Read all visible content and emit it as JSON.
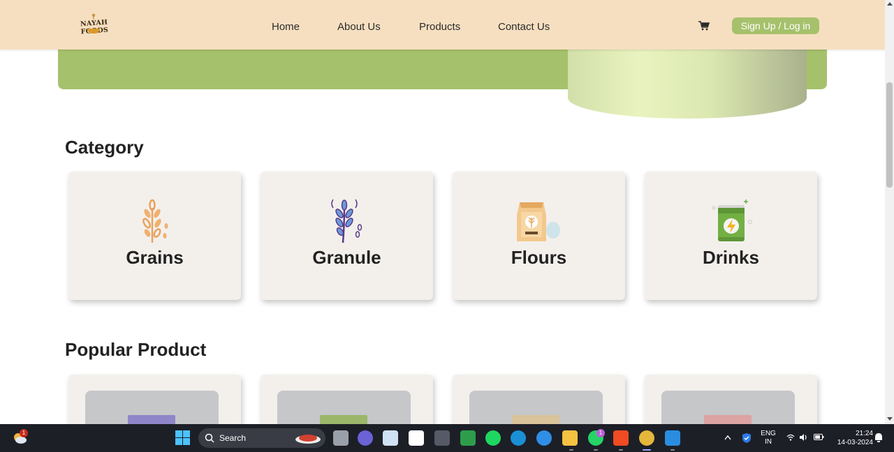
{
  "brand": {
    "name": "NAYAH FOODS"
  },
  "nav": {
    "links": [
      "Home",
      "About Us",
      "Products",
      "Contact Us"
    ],
    "signup_label": "Sign Up / Log in"
  },
  "sections": {
    "category_title": "Category",
    "popular_title": "Popular Product"
  },
  "categories": [
    {
      "label": "Grains",
      "icon": "wheat-icon"
    },
    {
      "label": "Granule",
      "icon": "wheat-stalk-icon"
    },
    {
      "label": "Flours",
      "icon": "flour-bag-icon"
    },
    {
      "label": "Drinks",
      "icon": "energy-drink-can-icon"
    }
  ],
  "colors": {
    "navbar_bg": "#f6dfc0",
    "accent_green": "#a6c16c",
    "card_bg": "#f3f0ec",
    "taskbar_bg": "#1d1f27"
  },
  "taskbar": {
    "search_placeholder": "Search",
    "weather_badge": "1",
    "whatsapp_badge": "1",
    "language": "ENG",
    "region": "IN",
    "time": "21:24",
    "date": "14-03-2024"
  }
}
